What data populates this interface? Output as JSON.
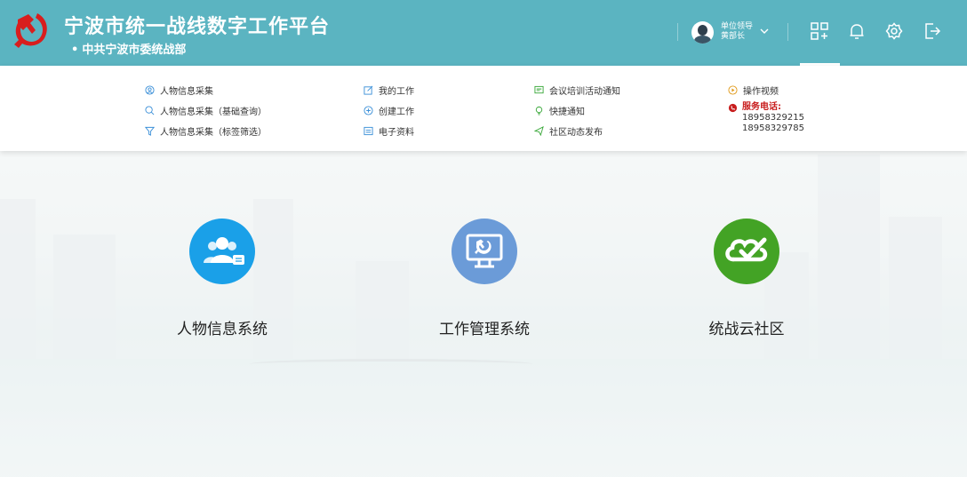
{
  "header": {
    "title": "宁波市统一战线数字工作平台",
    "subtitle": "中共宁波市委统战部",
    "user_line1": "单位领导",
    "user_line2": "黄部长"
  },
  "menu": {
    "col1": [
      "人物信息采集",
      "人物信息采集（基础查询）",
      "人物信息采集（标签筛选）"
    ],
    "col2": [
      "我的工作",
      "创建工作",
      "电子资料"
    ],
    "col3": [
      "会议培训活动通知",
      "快捷通知",
      "社区动态发布"
    ],
    "video": "操作视频",
    "service_label": "服务电话:",
    "phone1": "18958329215",
    "phone2": "18958329785"
  },
  "systems": [
    {
      "label": "人物信息系统",
      "color": "#1aa0e8"
    },
    {
      "label": "工作管理系统",
      "color": "#6b9bd8"
    },
    {
      "label": "统战云社区",
      "color": "#43a325"
    }
  ],
  "colors": {
    "header": "#5bb4c1",
    "accent_red": "#c81d1d"
  }
}
